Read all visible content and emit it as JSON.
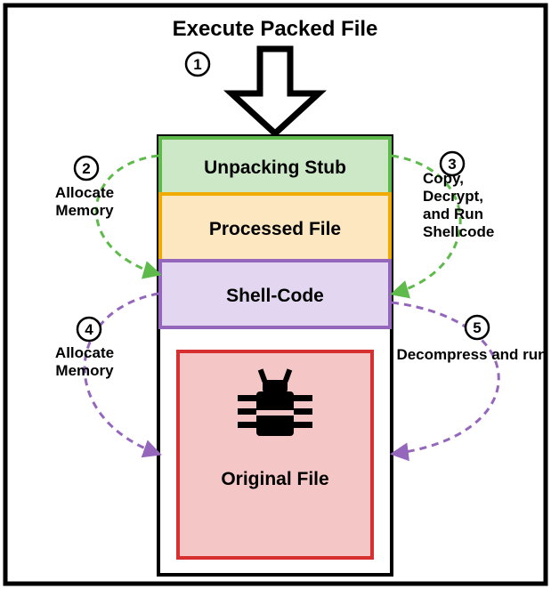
{
  "title": "Execute Packed File",
  "blocks": {
    "unpacking_stub": {
      "label": "Unpacking Stub",
      "fill": "#cce8c6",
      "stroke": "#5eba4b"
    },
    "processed_file": {
      "label": "Processed File",
      "fill": "#fde7c0",
      "stroke": "#f0ab00"
    },
    "shell_code": {
      "label": "Shell-Code",
      "fill": "#e2d6f0",
      "stroke": "#9467bd"
    },
    "original_file": {
      "label": "Original File",
      "fill": "#f5c6c6",
      "stroke": "#d73030"
    }
  },
  "steps": {
    "s1": "1",
    "s2": "2",
    "s3": "3",
    "s4": "4",
    "s5": "5"
  },
  "annotations": {
    "a2_line1": "Allocate",
    "a2_line2": "Memory",
    "a3_line1": "Copy,",
    "a3_line2": "Decrypt,",
    "a3_line3": "and Run",
    "a3_line4": "Shellcode",
    "a4_line1": "Allocate",
    "a4_line2": "Memory",
    "a5_line1": "Decompress and run"
  },
  "arrows": {
    "left_top": "#5eba4b",
    "right_top": "#5eba4b",
    "left_bot": "#9467bd",
    "right_bot": "#9467bd"
  },
  "icon": "bug-icon"
}
